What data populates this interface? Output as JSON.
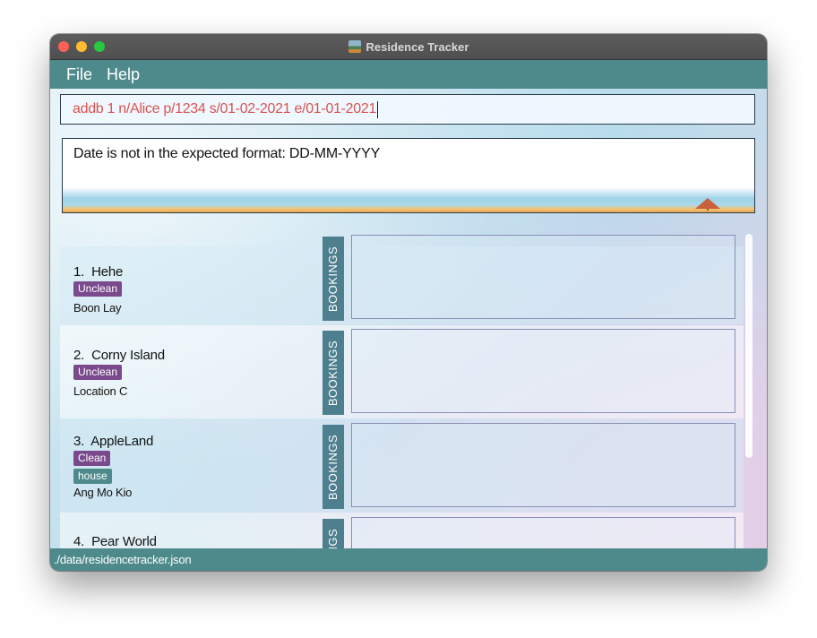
{
  "window": {
    "title": "Residence Tracker"
  },
  "menu": {
    "items": [
      "File",
      "Help"
    ]
  },
  "command": {
    "value": "addb 1 n/Alice p/1234 s/01-02-2021 e/01-01-2021"
  },
  "result": {
    "message": "Date is not in the expected format: DD-MM-YYYY"
  },
  "residences": [
    {
      "index": "1.",
      "name": "Hehe",
      "status": "Unclean",
      "tags": [],
      "address": "Boon Lay",
      "bookings_label": "BOOKINGS"
    },
    {
      "index": "2.",
      "name": "Corny Island",
      "status": "Unclean",
      "tags": [],
      "address": "Location C",
      "bookings_label": "BOOKINGS"
    },
    {
      "index": "3.",
      "name": "AppleLand",
      "status": "Clean",
      "tags": [
        "house"
      ],
      "address": "Ang Mo Kio",
      "bookings_label": "BOOKINGS"
    },
    {
      "index": "4.",
      "name": "Pear World",
      "status": "",
      "tags": [],
      "address": "",
      "bookings_label": "BOOKINGS"
    }
  ],
  "status_bar": {
    "path": "./data/residencetracker.json"
  },
  "colors": {
    "accent": "#4e8a8b",
    "status_tag": "#7a4a8c",
    "error_text": "#d9534f"
  }
}
